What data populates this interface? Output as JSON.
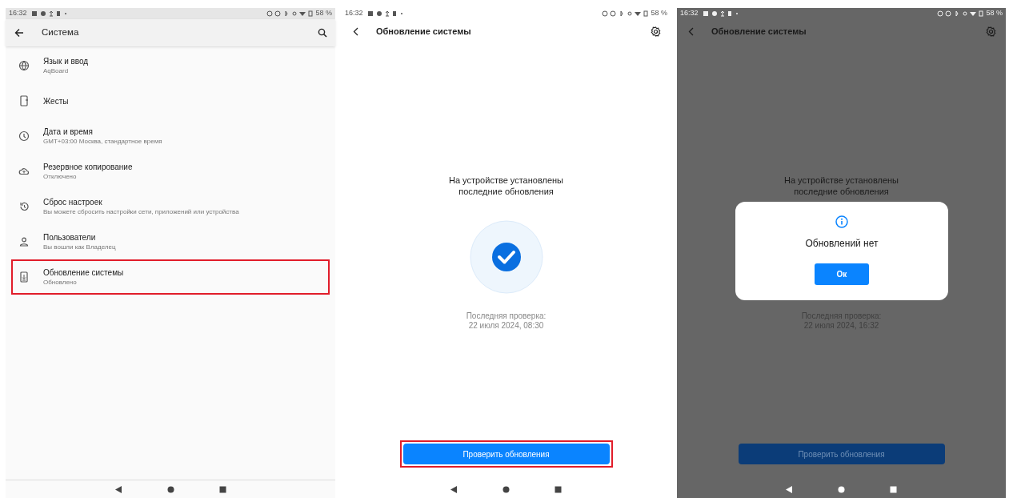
{
  "settings_screen": {
    "status_bar": {
      "time": "16:32",
      "battery": "58 %"
    },
    "toolbar": {
      "title": "Система"
    },
    "items": [
      {
        "title": "Язык и ввод",
        "subtitle": "AqBoard",
        "highlighted": false
      },
      {
        "title": "Жесты",
        "highlighted": false
      },
      {
        "title": "Дата и время",
        "subtitle": "GMT+03:00 Москва, стандартное время",
        "highlighted": false
      },
      {
        "title": "Резервное копирование",
        "subtitle": "Отключено",
        "highlighted": false
      },
      {
        "title": "Сброс настроек",
        "subtitle": "Вы можете сбросить настройки сети, приложений или устройства",
        "highlighted": false
      },
      {
        "title": "Пользователи",
        "subtitle": "Вы вошли как Владелец",
        "highlighted": false
      },
      {
        "title": "Обновление системы",
        "subtitle": "Обновлено",
        "highlighted": true
      }
    ]
  },
  "update_screens": [
    {
      "dimmed": false,
      "status_bar": {
        "time": "16:32",
        "battery": "58 %"
      },
      "toolbar": {
        "title": "Обновление системы"
      },
      "message": [
        "На устройстве установлены",
        "последние обновления"
      ],
      "last_check": [
        "Последняя проверка:",
        "22 июля 2024, 08:30"
      ],
      "button": {
        "label": "Проверить обновления",
        "highlighted": true
      }
    },
    {
      "dimmed": true,
      "status_bar": {
        "time": "16:32",
        "battery": "58 %"
      },
      "toolbar": {
        "title": "Обновление системы"
      },
      "message": [
        "На устройстве установлены",
        "последние обновления"
      ],
      "last_check": [
        "Последняя проверка:",
        "22 июля 2024, 16:32"
      ],
      "button": {
        "label": "Проверить обновления",
        "highlighted": false
      },
      "dialog": {
        "message": "Обновлений нет",
        "button": "Ок"
      }
    }
  ]
}
